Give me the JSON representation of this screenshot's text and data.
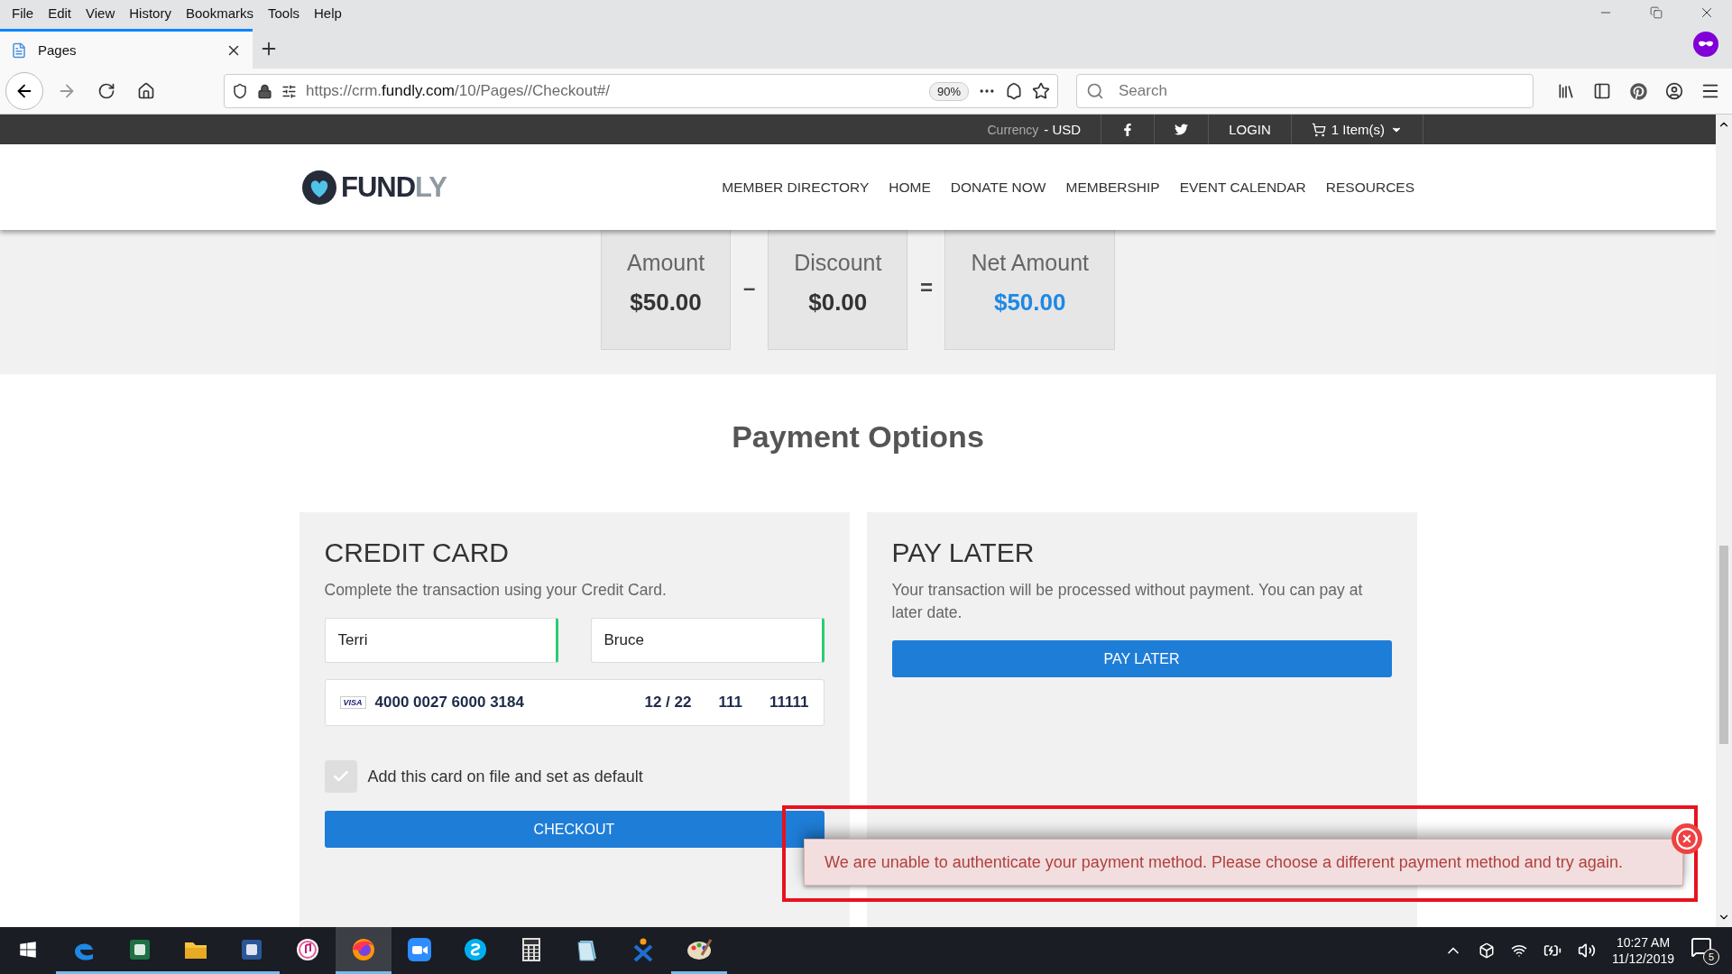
{
  "menu_bar": [
    "File",
    "Edit",
    "View",
    "History",
    "Bookmarks",
    "Tools",
    "Help"
  ],
  "tab": {
    "title": "Pages",
    "selected": true
  },
  "address_bar": {
    "url_prefix": "https://crm.",
    "url_domain": "fundly.com",
    "url_path": "/10/Pages//Checkout#/",
    "zoom": "90%"
  },
  "search": {
    "placeholder": "Search"
  },
  "site_topbar": {
    "currency_label": "Currency",
    "currency_value": "- USD",
    "login": "LOGIN",
    "cart": "1 Item(s)"
  },
  "logo": [
    "FUND",
    "LY"
  ],
  "nav": [
    "MEMBER DIRECTORY",
    "HOME",
    "DONATE NOW",
    "MEMBERSHIP",
    "EVENT CALENDAR",
    "RESOURCES"
  ],
  "summary": [
    {
      "label": "Amount",
      "value": "$50.00",
      "emphasized": false,
      "operator": "–"
    },
    {
      "label": "Discount",
      "value": "$0.00",
      "emphasized": false,
      "operator": "="
    },
    {
      "label": "Net Amount",
      "value": "$50.00",
      "emphasized": true
    }
  ],
  "payment_title": "Payment Options",
  "credit_card": {
    "title": "CREDIT CARD",
    "description": "Complete the transaction using your Credit Card.",
    "first_name": "Terri",
    "last_name": "Bruce",
    "card_brand": "VISA",
    "card_number": "4000 0027 6000 3184",
    "expiry": "12 / 22",
    "cvc": "111",
    "zip": "11111",
    "save_card": {
      "label": "Add this card on file and set as default",
      "checked": true
    },
    "button": "CHECKOUT"
  },
  "pay_later": {
    "title": "PAY LATER",
    "description": "Your transaction will be processed without payment. You can pay at later date.",
    "button": "PAY LATER"
  },
  "error_toast": {
    "message": "We are unable to authenticate your payment method. Please choose a different payment method and try again.",
    "highlighted": true
  },
  "taskbar": {
    "apps": [
      {
        "kind": "edge",
        "running": true,
        "selected": false
      },
      {
        "kind": "excel",
        "running": true,
        "selected": false
      },
      {
        "kind": "explorer",
        "running": true,
        "selected": false
      },
      {
        "kind": "word",
        "running": true,
        "selected": false
      },
      {
        "kind": "music",
        "running": false,
        "selected": false
      },
      {
        "kind": "firefox",
        "running": true,
        "selected": true
      },
      {
        "kind": "zoom",
        "running": false,
        "selected": false
      },
      {
        "kind": "skype",
        "running": false,
        "selected": false
      },
      {
        "kind": "calculator",
        "running": false,
        "selected": false
      },
      {
        "kind": "notes",
        "running": false,
        "selected": false
      },
      {
        "kind": "person",
        "running": false,
        "selected": false
      },
      {
        "kind": "paint",
        "running": true,
        "selected": false
      }
    ],
    "time": "10:27 AM",
    "date": "11/12/2019",
    "notifications": "5"
  }
}
